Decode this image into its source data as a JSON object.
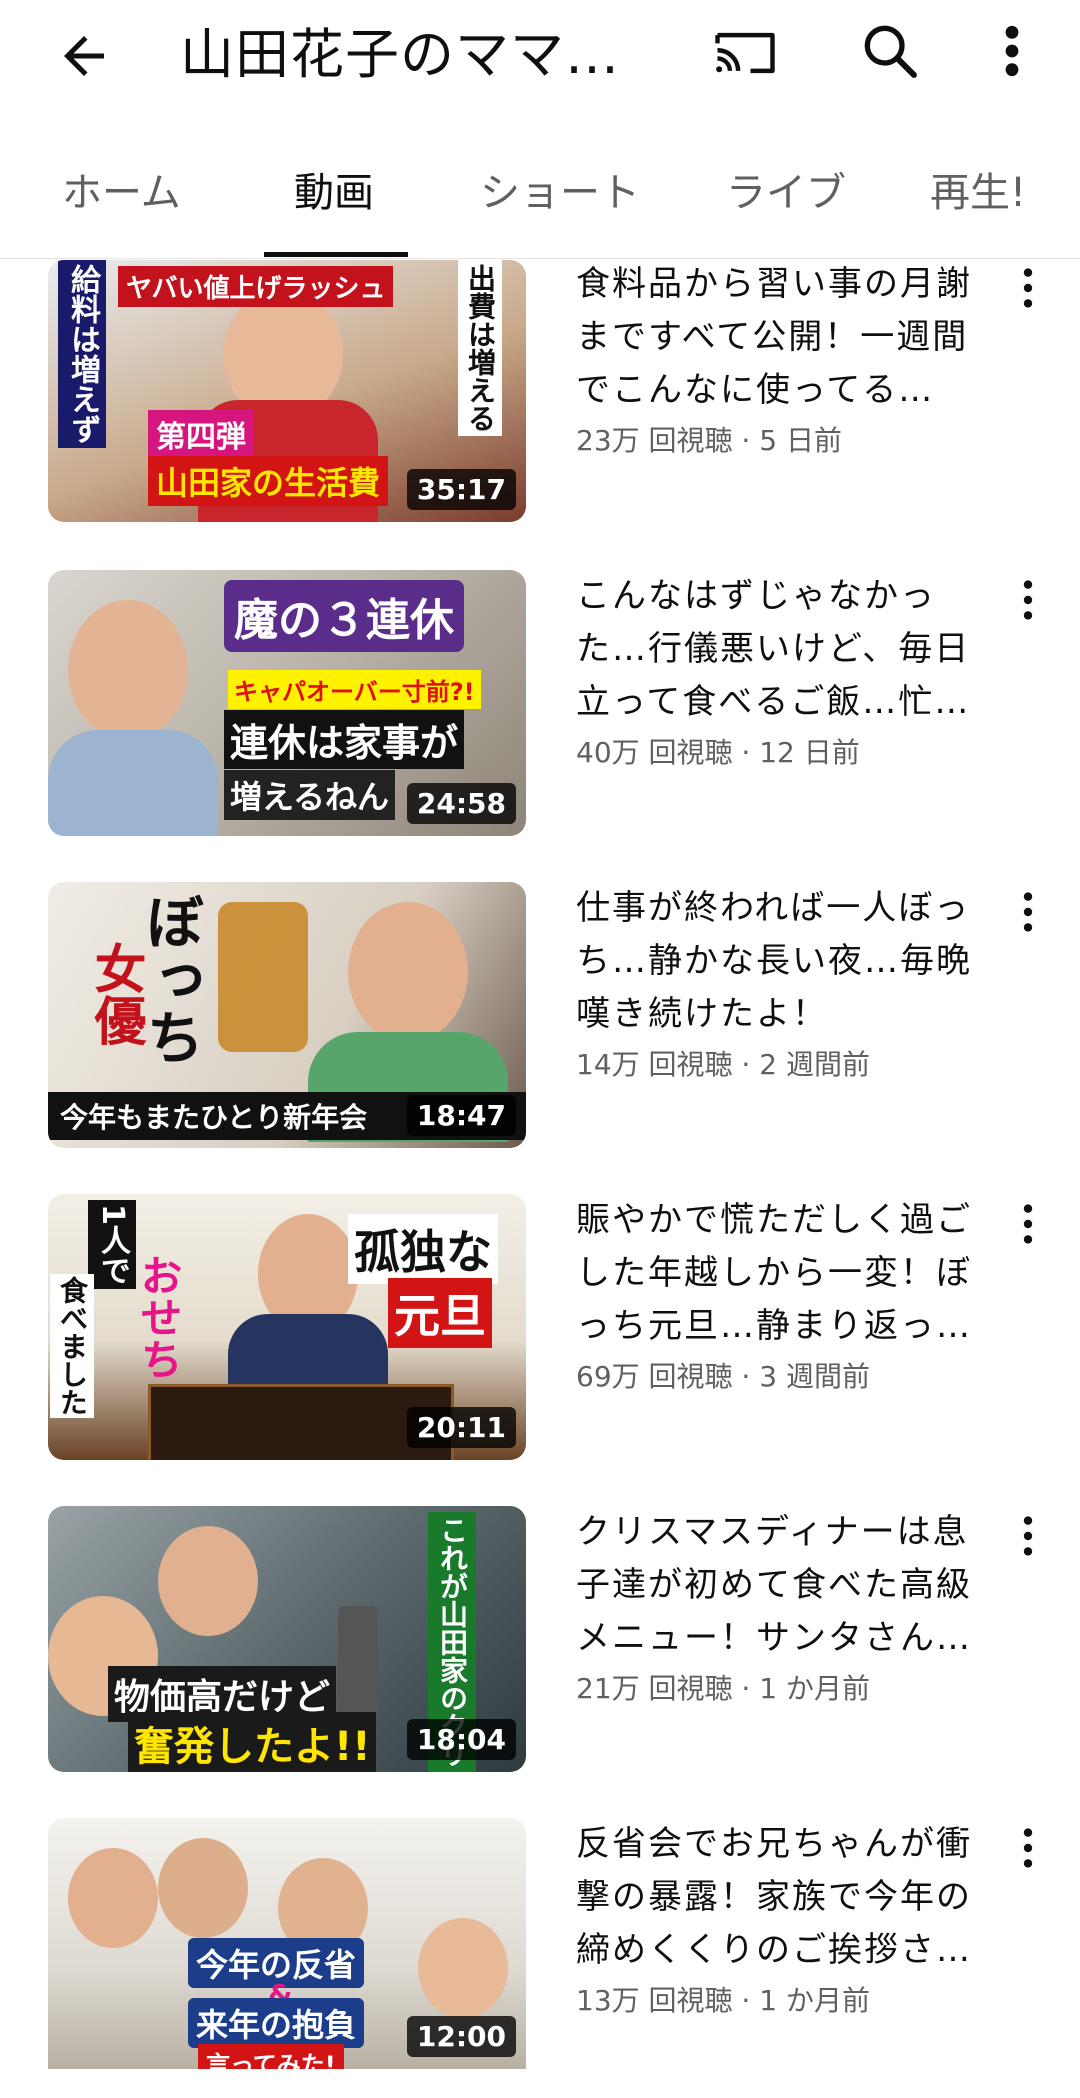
{
  "header": {
    "title": "山田花子のママ…",
    "back_icon": "arrow-back-icon",
    "cast_icon": "cast-icon",
    "search_icon": "search-icon",
    "more_icon": "more-vert-icon"
  },
  "tabs": [
    {
      "label": "ホーム",
      "active": false
    },
    {
      "label": "動画",
      "active": true
    },
    {
      "label": "ショート",
      "active": false
    },
    {
      "label": "ライブ",
      "active": false
    },
    {
      "label": "再生!",
      "active": false
    }
  ],
  "videos": [
    {
      "title": "食料品から習い事の月謝まですべて公開！一週間でこんなに使ってる…",
      "stats": "23万 回視聴 · 5 日前",
      "duration": "35:17",
      "thumb_texts": [
        "ヤバい値上げラッシュ",
        "給料は増えず",
        "第四弾",
        "山田家の生活費",
        "出費は増える"
      ]
    },
    {
      "title": "こんなはずじゃなかった…行儀悪いけど、毎日立って食べるご飯…忙し…",
      "stats": "40万 回視聴 · 12 日前",
      "duration": "24:58",
      "thumb_texts": [
        "魔の３連休",
        "キャパオーバー寸前?!",
        "連休は家事が",
        "増えるねん"
      ]
    },
    {
      "title": "仕事が終われば一人ぼっち…静かな長い夜…毎晩嘆き続けたよ！",
      "stats": "14万 回視聴 · 2 週間前",
      "duration": "18:47",
      "thumb_texts": [
        "ぼっち",
        "女優",
        "今年もまたひとり新年会"
      ]
    },
    {
      "title": "賑やかで慌ただしく過ごした年越しから一変！ぼっち元旦…静まり返った…",
      "stats": "69万 回視聴 · 3 週間前",
      "duration": "20:11",
      "thumb_texts": [
        "1人で",
        "おせち",
        "食べました",
        "孤独な",
        "元旦"
      ]
    },
    {
      "title": "クリスマスディナーは息子達が初めて食べた高級メニュー！サンタさん…",
      "stats": "21万 回視聴 · 1 か月前",
      "duration": "18:04",
      "thumb_texts": [
        "これが山田家のクリスマス",
        "物価高だけど",
        "奮発したよ!!"
      ]
    },
    {
      "title": "反省会でお兄ちゃんが衝撃の暴露！家族で今年の締めくくりのご挨拶さ…",
      "stats": "13万 回視聴 · 1 か月前",
      "duration": "12:00",
      "thumb_texts": [
        "今年の反省",
        "&",
        "来年の抱負",
        "言ってみた!"
      ]
    }
  ],
  "colors": {
    "text_primary": "#0f0f0f",
    "text_secondary": "#606060",
    "duration_bg": "#000000"
  }
}
